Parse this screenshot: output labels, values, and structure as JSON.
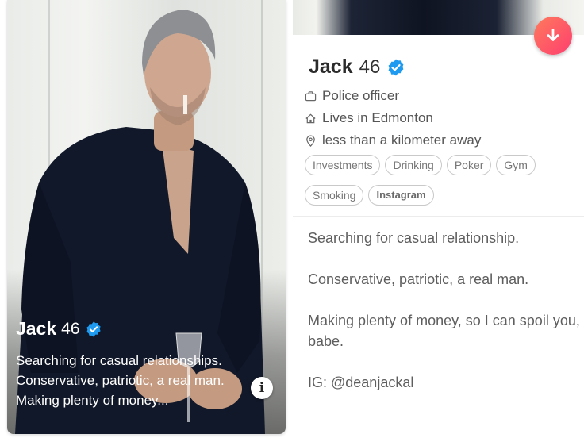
{
  "card": {
    "name": "Jack",
    "age": "46",
    "bio_lines": [
      "Searching for casual relationships.",
      "Conservative, patriotic, a real man.",
      "Making plenty of money..."
    ],
    "info_label": "i"
  },
  "profile": {
    "name": "Jack",
    "age": "46",
    "job": "Police officer",
    "lives": "Lives in Edmonton",
    "distance": "less than a kilometer away",
    "interests_row1": [
      "Investments",
      "Drinking",
      "Poker",
      "Gym"
    ],
    "interests_row2": [
      "Smoking",
      "Instagram"
    ],
    "bio": [
      "Searching for casual relationship.",
      "Conservative, patriotic, a real man.",
      "Making plenty of money, so I can spoil you, babe.",
      "IG: @deanjackal"
    ]
  },
  "icons": {
    "verified": "verified-badge-icon",
    "job": "briefcase-icon",
    "home": "home-icon",
    "location": "location-pin-icon",
    "collapse": "arrow-down-icon",
    "info": "info-icon"
  },
  "colors": {
    "verified_blue": "#1e9bf0",
    "action_gradient_start": "#ff7a5c",
    "action_gradient_end": "#fd3f6f",
    "shirt_navy": "#111829"
  }
}
